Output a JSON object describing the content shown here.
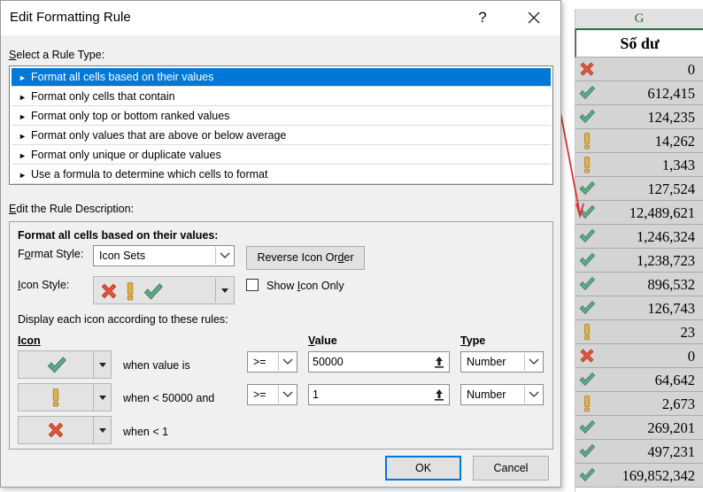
{
  "dialog": {
    "title": "Edit Formatting Rule",
    "help_label": "?",
    "select_rule_type_label": "Select a Rule Type:",
    "rule_types": [
      "Format all cells based on their values",
      "Format only cells that contain",
      "Format only top or bottom ranked values",
      "Format only values that are above or below average",
      "Format only unique or duplicate values",
      "Use a formula to determine which cells to format"
    ],
    "selected_rule_index": 0,
    "edit_description_label": "Edit the Rule Description:",
    "format_all_heading": "Format all cells based on their values:",
    "format_style_label": "Format Style:",
    "format_style_value": "Icon Sets",
    "reverse_icon_order_label": "Reverse Icon Order",
    "icon_style_label": "Icon Style:",
    "show_icon_only_label": "Show Icon Only",
    "display_rules_label": "Display each icon according to these rules:",
    "col_icon": "Icon",
    "col_value": "Value",
    "col_type": "Type",
    "rules": [
      {
        "icon": "check-icon",
        "condition": "when value is",
        "operator": ">=",
        "value": "50000",
        "type": "Number"
      },
      {
        "icon": "exclamation-icon",
        "condition": "when < 50000 and",
        "operator": ">=",
        "value": "1",
        "type": "Number"
      },
      {
        "icon": "cross-icon",
        "condition": "when < 1"
      }
    ],
    "ok_label": "OK",
    "cancel_label": "Cancel"
  },
  "sheet": {
    "column_letter": "G",
    "header": "Số dư",
    "rows": [
      {
        "icon": "cross-icon",
        "value": "0"
      },
      {
        "icon": "check-icon",
        "value": "612,415"
      },
      {
        "icon": "check-icon",
        "value": "124,235"
      },
      {
        "icon": "exclamation-icon",
        "value": "14,262"
      },
      {
        "icon": "exclamation-icon",
        "value": "1,343"
      },
      {
        "icon": "check-icon",
        "value": "127,524"
      },
      {
        "icon": "check-icon",
        "value": "12,489,621"
      },
      {
        "icon": "check-icon",
        "value": "1,246,324"
      },
      {
        "icon": "check-icon",
        "value": "1,238,723"
      },
      {
        "icon": "check-icon",
        "value": "896,532"
      },
      {
        "icon": "check-icon",
        "value": "126,743"
      },
      {
        "icon": "exclamation-icon",
        "value": "23"
      },
      {
        "icon": "cross-icon",
        "value": "0"
      },
      {
        "icon": "check-icon",
        "value": "64,642"
      },
      {
        "icon": "exclamation-icon",
        "value": "2,673"
      },
      {
        "icon": "check-icon",
        "value": "269,201"
      },
      {
        "icon": "check-icon",
        "value": "497,231"
      },
      {
        "icon": "check-icon",
        "value": "169,852,342"
      }
    ]
  },
  "colors": {
    "check": "#5fa886",
    "exclamation": "#e0b24c",
    "cross": "#e2553b",
    "selection": "#0078d7",
    "arrow": "#e03030"
  }
}
